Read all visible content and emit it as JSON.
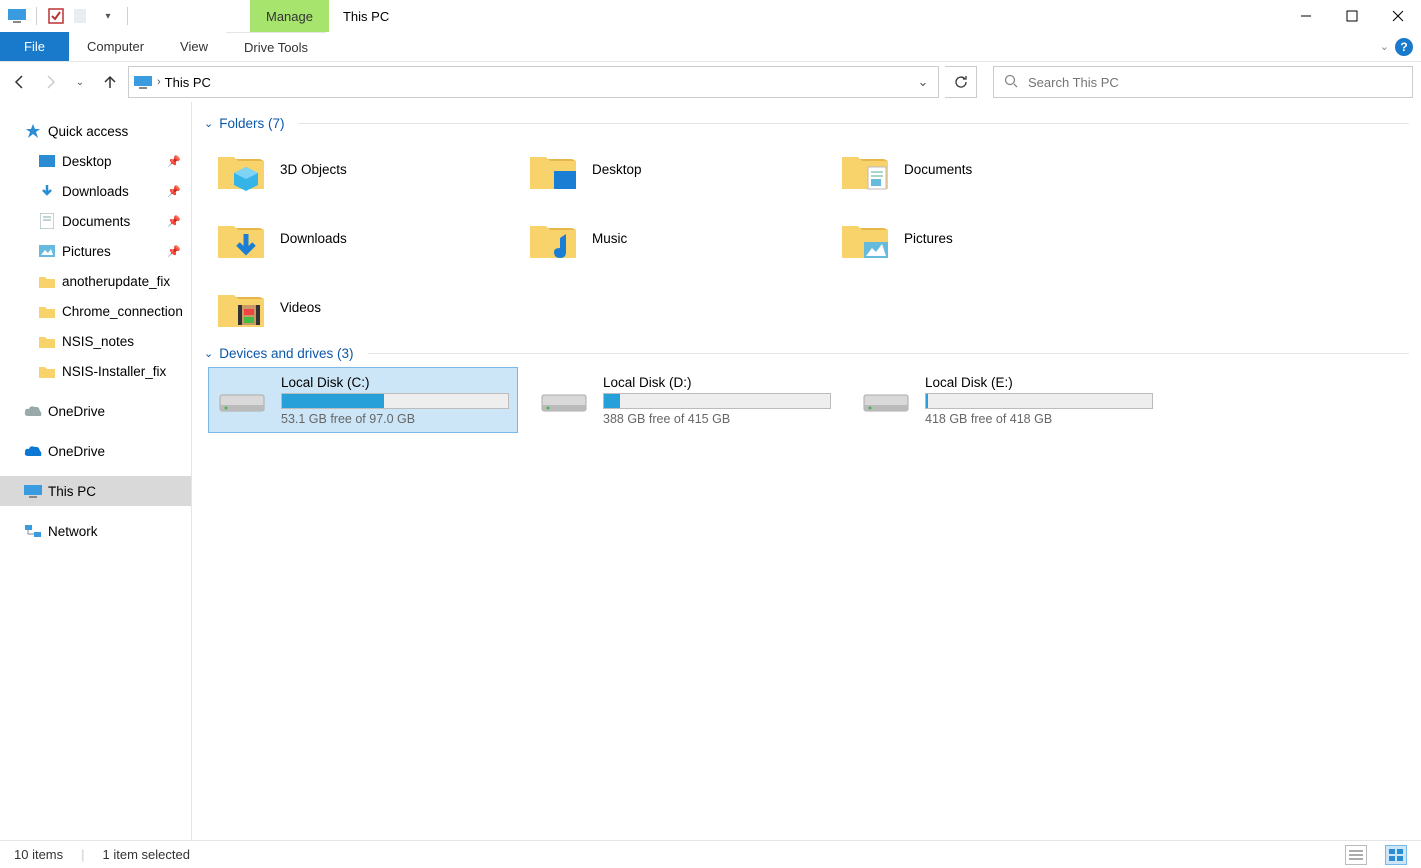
{
  "window": {
    "title": "This PC"
  },
  "tabs": {
    "context_label": "Manage",
    "file": "File",
    "computer": "Computer",
    "view": "View",
    "drive_tools": "Drive Tools"
  },
  "address": {
    "location": "This PC"
  },
  "search": {
    "placeholder": "Search This PC"
  },
  "sidebar": {
    "quick_access": "Quick access",
    "items": [
      {
        "label": "Desktop",
        "pinned": true
      },
      {
        "label": "Downloads",
        "pinned": true
      },
      {
        "label": "Documents",
        "pinned": true
      },
      {
        "label": "Pictures",
        "pinned": true
      },
      {
        "label": "anotherupdate_fix",
        "pinned": false
      },
      {
        "label": "Chrome_connection",
        "pinned": false
      },
      {
        "label": "NSIS_notes",
        "pinned": false
      },
      {
        "label": "NSIS-Installer_fix",
        "pinned": false
      }
    ],
    "onedrive1": "OneDrive",
    "onedrive2": "OneDrive",
    "this_pc": "This PC",
    "network": "Network"
  },
  "groups": {
    "folders": {
      "header": "Folders (7)",
      "items": [
        {
          "label": "3D Objects"
        },
        {
          "label": "Desktop"
        },
        {
          "label": "Documents"
        },
        {
          "label": "Downloads"
        },
        {
          "label": "Music"
        },
        {
          "label": "Pictures"
        },
        {
          "label": "Videos"
        }
      ]
    },
    "drives": {
      "header": "Devices and drives (3)",
      "items": [
        {
          "name": "Local Disk (C:)",
          "free": "53.1 GB free of 97.0 GB",
          "used_pct": 45,
          "selected": true
        },
        {
          "name": "Local Disk (D:)",
          "free": "388 GB free of 415 GB",
          "used_pct": 7,
          "selected": false
        },
        {
          "name": "Local Disk (E:)",
          "free": "418 GB free of 418 GB",
          "used_pct": 1,
          "selected": false
        }
      ]
    }
  },
  "status": {
    "count": "10 items",
    "selected": "1 item selected"
  }
}
